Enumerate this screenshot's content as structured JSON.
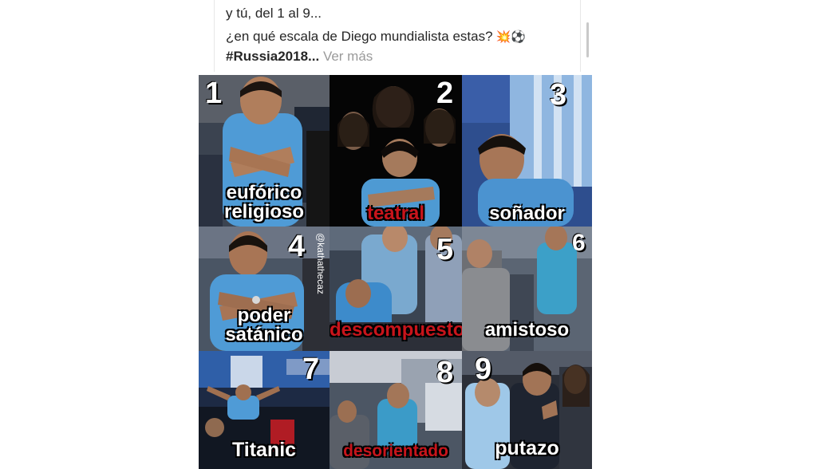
{
  "caption": {
    "line1": "y tú, del 1 al 9...",
    "line2": "¿en qué escala de Diego mundialista estas?",
    "line2_emojis": "💥⚽",
    "hashtag": "#Russia2018...",
    "more": "Ver más"
  },
  "tiles": [
    {
      "number": "1",
      "label_lines": [
        "eufórico",
        "religioso"
      ],
      "label_color": "white"
    },
    {
      "number": "2",
      "label_lines": [
        "teatral"
      ],
      "label_color": "red"
    },
    {
      "number": "3",
      "label_lines": [
        "soñador"
      ],
      "label_color": "white"
    },
    {
      "number": "4",
      "label_lines": [
        "poder",
        "satánico"
      ],
      "label_color": "white",
      "handle": "@kathathecaz"
    },
    {
      "number": "5",
      "label_lines": [
        "descompuesto"
      ],
      "label_color": "red"
    },
    {
      "number": "6",
      "label_lines": [
        "amistoso"
      ],
      "label_color": "white"
    },
    {
      "number": "7",
      "label_lines": [
        "Titanic"
      ],
      "label_color": "white"
    },
    {
      "number": "8",
      "label_lines": [
        "desorientado"
      ],
      "label_color": "red"
    },
    {
      "number": "9",
      "label_lines": [
        "putazo"
      ],
      "label_color": "white"
    }
  ],
  "colors": {
    "label_red": "#c8141b",
    "label_white": "#ffffff",
    "argentina_blue": "#5aa6dc"
  }
}
